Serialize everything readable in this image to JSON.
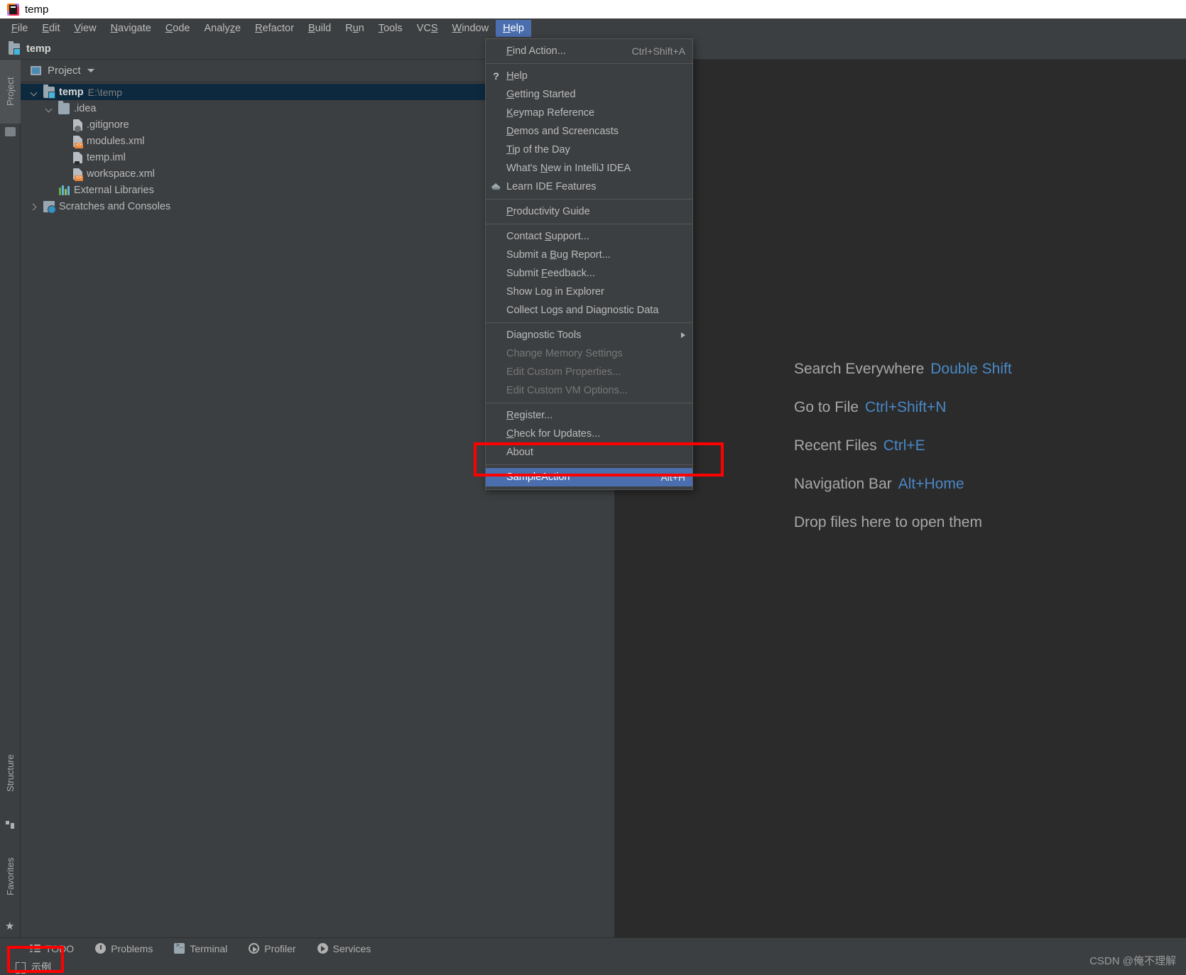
{
  "window": {
    "title": "temp",
    "logo_icon": "intellij-idea-logo"
  },
  "menubar": {
    "items": [
      {
        "label": "File",
        "mnemonic": "F"
      },
      {
        "label": "Edit",
        "mnemonic": "E"
      },
      {
        "label": "View",
        "mnemonic": "V"
      },
      {
        "label": "Navigate",
        "mnemonic": "N"
      },
      {
        "label": "Code",
        "mnemonic": "C"
      },
      {
        "label": "Analyze",
        "mnemonic": "z"
      },
      {
        "label": "Refactor",
        "mnemonic": "R"
      },
      {
        "label": "Build",
        "mnemonic": "B"
      },
      {
        "label": "Run",
        "mnemonic": "u"
      },
      {
        "label": "Tools",
        "mnemonic": "T"
      },
      {
        "label": "VCS",
        "mnemonic": "S"
      },
      {
        "label": "Window",
        "mnemonic": "W"
      },
      {
        "label": "Help",
        "mnemonic": "H",
        "active": true
      }
    ]
  },
  "navstrip": {
    "breadcrumb": "temp",
    "icon": "module-icon"
  },
  "left_strip": {
    "tabs": [
      {
        "label": "Project",
        "icon": "project-icon",
        "selected": true
      },
      {
        "label": "Structure",
        "icon": "structure-icon",
        "selected": false
      },
      {
        "label": "Favorites",
        "icon": "star-icon",
        "selected": false
      }
    ]
  },
  "project_panel": {
    "header_label": "Project",
    "header_icon": "project-view-icon",
    "dropdown_icon": "chevron-down-icon",
    "tree": [
      {
        "name": "temp",
        "detail": "E:\\temp",
        "icon": "module-icon",
        "indent": 0,
        "twist": "open",
        "bold": true,
        "selected": true
      },
      {
        "name": ".idea",
        "detail": "",
        "icon": "folder-icon",
        "indent": 1,
        "twist": "open",
        "bold": false,
        "selected": false
      },
      {
        "name": ".gitignore",
        "detail": "",
        "icon": "gitignore-file-icon",
        "indent": 2,
        "twist": "none",
        "bold": false,
        "selected": false
      },
      {
        "name": "modules.xml",
        "detail": "",
        "icon": "xml-file-icon",
        "indent": 2,
        "twist": "none",
        "bold": false,
        "selected": false
      },
      {
        "name": "temp.iml",
        "detail": "",
        "icon": "iml-file-icon",
        "indent": 2,
        "twist": "none",
        "bold": false,
        "selected": false
      },
      {
        "name": "workspace.xml",
        "detail": "",
        "icon": "xml-file-icon",
        "indent": 2,
        "twist": "none",
        "bold": false,
        "selected": false
      },
      {
        "name": "External Libraries",
        "detail": "",
        "icon": "libraries-icon",
        "indent": 1,
        "twist": "none",
        "bold": false,
        "selected": false
      },
      {
        "name": "Scratches and Consoles",
        "detail": "",
        "icon": "scratches-icon",
        "indent": 0,
        "twist": "closed",
        "bold": false,
        "selected": false
      }
    ]
  },
  "help_menu": {
    "items": [
      {
        "label": "Find Action...",
        "shortcut": "Ctrl+Shift+A",
        "mnemonic": "F",
        "icon": "",
        "disabled": false,
        "highlighted": false,
        "submenu": false
      },
      {
        "separator": true
      },
      {
        "label": "Help",
        "shortcut": "",
        "mnemonic": "H",
        "icon": "question-mark-icon",
        "disabled": false,
        "highlighted": false,
        "submenu": false
      },
      {
        "label": "Getting Started",
        "shortcut": "",
        "mnemonic": "G",
        "icon": "",
        "disabled": false,
        "highlighted": false,
        "submenu": false
      },
      {
        "label": "Keymap Reference",
        "shortcut": "",
        "mnemonic": "K",
        "icon": "",
        "disabled": false,
        "highlighted": false,
        "submenu": false
      },
      {
        "label": "Demos and Screencasts",
        "shortcut": "",
        "mnemonic": "D",
        "icon": "",
        "disabled": false,
        "highlighted": false,
        "submenu": false
      },
      {
        "label": "Tip of the Day",
        "shortcut": "",
        "mnemonic": "Ti",
        "icon": "",
        "disabled": false,
        "highlighted": false,
        "submenu": false
      },
      {
        "label": "What's New in IntelliJ IDEA",
        "shortcut": "",
        "mnemonic": "N",
        "icon": "",
        "disabled": false,
        "highlighted": false,
        "submenu": false
      },
      {
        "label": "Learn IDE Features",
        "shortcut": "",
        "mnemonic": "",
        "icon": "graduation-cap-icon",
        "disabled": false,
        "highlighted": false,
        "submenu": false
      },
      {
        "separator": true
      },
      {
        "label": "Productivity Guide",
        "shortcut": "",
        "mnemonic": "P",
        "icon": "",
        "disabled": false,
        "highlighted": false,
        "submenu": false
      },
      {
        "separator": true
      },
      {
        "label": "Contact Support...",
        "shortcut": "",
        "mnemonic": "S",
        "icon": "",
        "disabled": false,
        "highlighted": false,
        "submenu": false
      },
      {
        "label": "Submit a Bug Report...",
        "shortcut": "",
        "mnemonic": "B",
        "icon": "",
        "disabled": false,
        "highlighted": false,
        "submenu": false
      },
      {
        "label": "Submit Feedback...",
        "shortcut": "",
        "mnemonic": "F",
        "icon": "",
        "disabled": false,
        "highlighted": false,
        "submenu": false
      },
      {
        "label": "Show Log in Explorer",
        "shortcut": "",
        "mnemonic": "",
        "icon": "",
        "disabled": false,
        "highlighted": false,
        "submenu": false
      },
      {
        "label": "Collect Logs and Diagnostic Data",
        "shortcut": "",
        "mnemonic": "",
        "icon": "",
        "disabled": false,
        "highlighted": false,
        "submenu": false
      },
      {
        "separator": true
      },
      {
        "label": "Diagnostic Tools",
        "shortcut": "",
        "mnemonic": "",
        "icon": "",
        "disabled": false,
        "highlighted": false,
        "submenu": true
      },
      {
        "label": "Change Memory Settings",
        "shortcut": "",
        "mnemonic": "",
        "icon": "",
        "disabled": true,
        "highlighted": false,
        "submenu": false
      },
      {
        "label": "Edit Custom Properties...",
        "shortcut": "",
        "mnemonic": "",
        "icon": "",
        "disabled": true,
        "highlighted": false,
        "submenu": false
      },
      {
        "label": "Edit Custom VM Options...",
        "shortcut": "",
        "mnemonic": "",
        "icon": "",
        "disabled": true,
        "highlighted": false,
        "submenu": false
      },
      {
        "separator": true
      },
      {
        "label": "Register...",
        "shortcut": "",
        "mnemonic": "R",
        "icon": "",
        "disabled": false,
        "highlighted": false,
        "submenu": false
      },
      {
        "label": "Check for Updates...",
        "shortcut": "",
        "mnemonic": "C",
        "icon": "",
        "disabled": false,
        "highlighted": false,
        "submenu": false
      },
      {
        "label": "About",
        "shortcut": "",
        "mnemonic": "",
        "icon": "",
        "disabled": false,
        "highlighted": false,
        "submenu": false
      },
      {
        "separator": true
      },
      {
        "label": "SampleAction",
        "shortcut": "Alt+H",
        "mnemonic": "",
        "icon": "",
        "disabled": false,
        "highlighted": true,
        "submenu": false
      }
    ]
  },
  "editor_hints": [
    {
      "label": "Search Everywhere",
      "key": "Double Shift"
    },
    {
      "label": "Go to File",
      "key": "Ctrl+Shift+N"
    },
    {
      "label": "Recent Files",
      "key": "Ctrl+E"
    },
    {
      "label": "Navigation Bar",
      "key": "Alt+Home"
    },
    {
      "label": "Drop files here to open them",
      "key": ""
    }
  ],
  "bottom_bar": {
    "items": [
      {
        "label": "TODO",
        "icon": "todo-icon"
      },
      {
        "label": "Problems",
        "icon": "problems-icon"
      },
      {
        "label": "Terminal",
        "icon": "terminal-icon"
      },
      {
        "label": "Profiler",
        "icon": "profiler-icon"
      },
      {
        "label": "Services",
        "icon": "services-icon"
      }
    ]
  },
  "status_bar": {
    "item_label": "示例",
    "item_icon": "bracket-icon",
    "watermark": "CSDN @俺不理解"
  },
  "colors": {
    "accent_blue": "#4b6eaf",
    "hint_key_blue": "#4a88c7",
    "annotation_red": "#ff0000",
    "panel_bg": "#3c3f41",
    "editor_bg": "#2b2b2b",
    "tree_selection": "#0d293e"
  }
}
